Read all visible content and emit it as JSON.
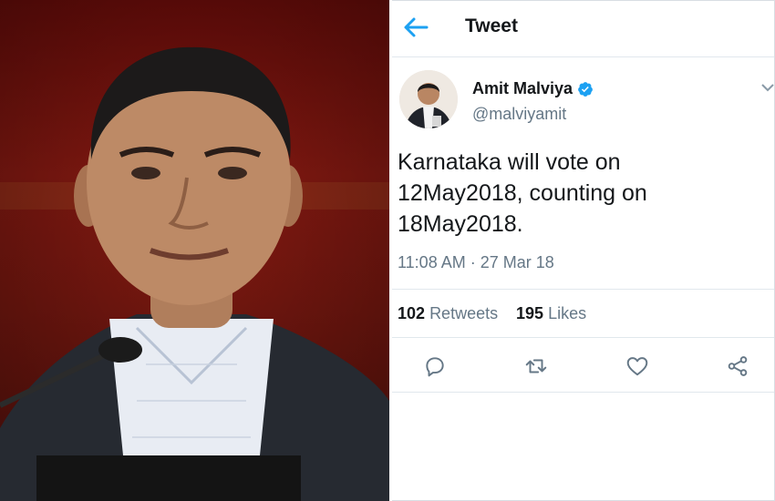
{
  "header": {
    "title": "Tweet"
  },
  "author": {
    "name": "Amit Malviya",
    "handle": "@malviyamit",
    "verified": true
  },
  "tweet": {
    "lines": [
      "Karnataka will vote on",
      "12May2018, counting on",
      "18May2018."
    ],
    "timestamp": "11:08 AM · 27 Mar 18"
  },
  "stats": {
    "retweets_count": "102",
    "retweets_label": "Retweets",
    "likes_count": "195",
    "likes_label": "Likes"
  },
  "icons": {
    "back": "arrow-left-icon",
    "verified": "verified-badge-icon",
    "caret": "chevron-down-icon",
    "reply": "reply-icon",
    "retweet": "retweet-icon",
    "like": "heart-icon",
    "share": "share-icon"
  },
  "colors": {
    "accent": "#1da1f2",
    "text": "#14171a",
    "muted": "#657786",
    "border": "#e1e8ed",
    "photo_background": "#7a1810"
  }
}
